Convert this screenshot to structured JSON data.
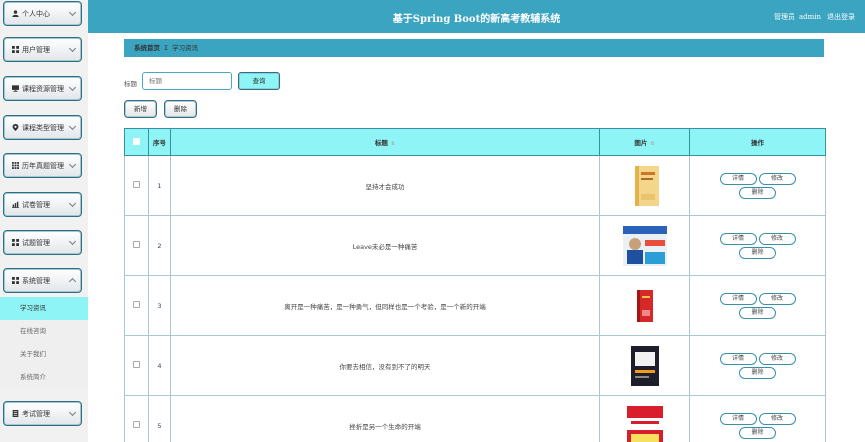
{
  "header": {
    "title": "基于Spring Boot的新高考教辅系统",
    "role": "管理员",
    "username": "admin",
    "logout": "退出登录"
  },
  "sidebar": {
    "groups": [
      {
        "label": "个人中心",
        "icon": "person-icon"
      },
      {
        "label": "用户管理",
        "icon": "grid-icon"
      },
      {
        "label": "课程资源管理",
        "icon": "monitor-icon"
      },
      {
        "label": "课程类型管理",
        "icon": "pin-icon"
      },
      {
        "label": "历年真题管理",
        "icon": "apps-icon"
      },
      {
        "label": "试卷管理",
        "icon": "chart-icon"
      },
      {
        "label": "试题管理",
        "icon": "grid-icon"
      },
      {
        "label": "系统管理",
        "icon": "grid-icon"
      },
      {
        "label": "考试管理",
        "icon": "file-icon"
      }
    ],
    "sub_items": [
      "学习资讯",
      "在线咨询",
      "关于我们",
      "系统简介"
    ]
  },
  "breadcrumb": {
    "home": "系统首页",
    "separator": "Σ",
    "current": "学习资讯"
  },
  "search": {
    "label": "标题",
    "placeholder": "标题",
    "button": "查询"
  },
  "toolbar": {
    "add": "新增",
    "delete": "删除"
  },
  "table": {
    "headers": {
      "index": "序号",
      "title": "标题",
      "image": "图片",
      "actions": "操作"
    },
    "actions": {
      "detail": "详情",
      "edit": "修改",
      "delete": "删除"
    },
    "rows": [
      {
        "index": "1",
        "title": "坚持才会成功"
      },
      {
        "index": "2",
        "title": "Leave未必是一种痛苦"
      },
      {
        "index": "3",
        "title": "离开是一种痛苦，是一种勇气，但同样也是一个考验，是一个新的开端"
      },
      {
        "index": "4",
        "title": "你要去相信，没有到不了的明天"
      },
      {
        "index": "5",
        "title": "挫折是另一个生命的开端"
      }
    ]
  },
  "colors": {
    "accent": "#3aa4c1",
    "highlight": "#8ff4f6",
    "border": "#2f6f84"
  }
}
